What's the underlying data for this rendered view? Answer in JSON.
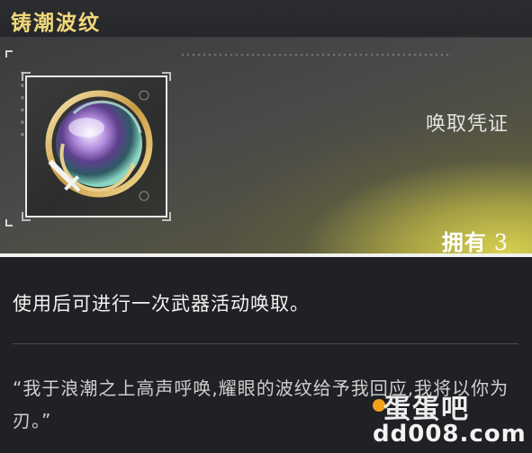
{
  "header": {
    "title": "铸潮波纹"
  },
  "item": {
    "icon": "weapon-orb-icon",
    "category_label": "唤取凭证",
    "owned_label": "拥有",
    "owned_count": "3"
  },
  "description": "使用后可进行一次武器活动唤取。",
  "quote": "“我于浪潮之上高声呼唤,耀眼的波纹给予我回应,我将以你为刃。”",
  "watermark": {
    "top": "蛋蛋吧",
    "bottom": "dd008.com"
  },
  "colors": {
    "title": "#f1d97a",
    "accent_glow": "#ded652",
    "background": "#1f2124"
  }
}
